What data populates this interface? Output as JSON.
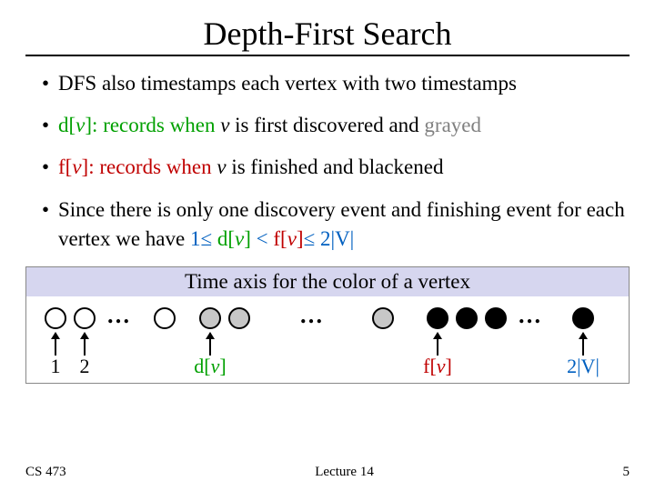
{
  "title": "Depth-First Search",
  "bullets": {
    "b1": "DFS also timestamps each vertex with two timestamps",
    "b2_pre": "d[",
    "b2_v": "v",
    "b2_mid": "]: records when ",
    "b2_v2": "v",
    "b2_post": " is first discovered and ",
    "b2_gray": "grayed",
    "b3_pre": "f[",
    "b3_v": "v",
    "b3_mid": "]: records when ",
    "b3_v2": "v",
    "b3_post": " is finished and ",
    "b3_black": "blackened",
    "b4_pre": "Since there is only one discovery event and finishing event for each vertex we have ",
    "b4_one": "1",
    "b4_le1": "≤",
    "b4_d": " d[",
    "b4_v1": "v",
    "b4_mid1": "] ",
    "b4_lt": "<",
    "b4_f": " f[",
    "b4_v2": "v",
    "b4_mid2": "]",
    "b4_le2": "≤",
    "b4_2v": " 2|V|"
  },
  "diagram": {
    "title": "Time axis for the color of a vertex",
    "labels": {
      "l1": "1",
      "l2": "2",
      "dv_pre": "d[",
      "dv_v": "v",
      "dv_post": "]",
      "fv_pre": "f[",
      "fv_v": "v",
      "fv_post": "]",
      "end": "2|V|"
    },
    "dots": "…"
  },
  "footer": {
    "left": "CS 473",
    "center": "Lecture 14",
    "right": "5"
  }
}
